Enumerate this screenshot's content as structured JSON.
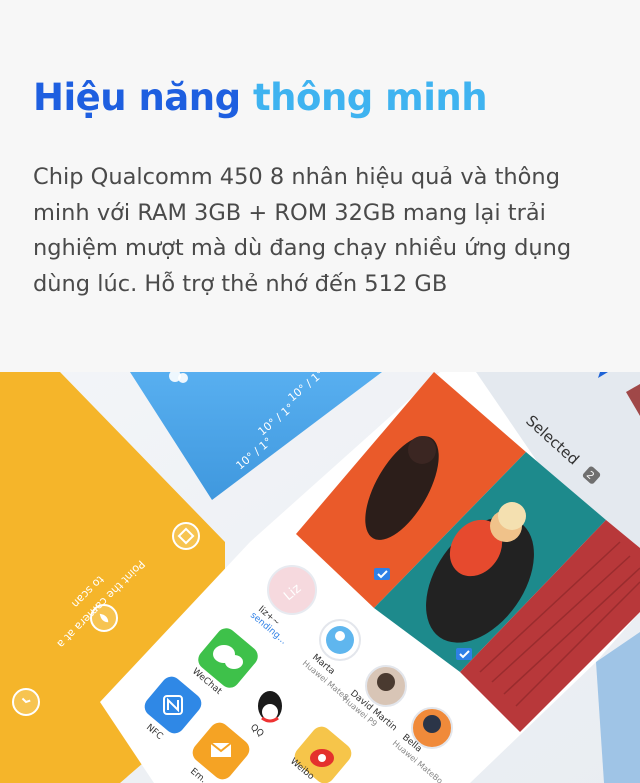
{
  "header": {
    "title_part1": "Hiệu năng",
    "title_part2": "thông minh",
    "description": "Chip Qualcomm 450 8 nhân hiệu quả và thông minh với RAM 3GB + ROM 32GB mang lại trải nghiệm mượt mà dù đang chạy nhiều ứng dụng dùng lúc. Hỗ trợ thẻ nhớ đến 512 GB"
  },
  "colors": {
    "title_primary": "#1e5fe0",
    "title_accent": "#3fb3f0",
    "yellow_card": "#f5b52a",
    "weather_card": "#4ea4e6",
    "photo_orange": "#ea5a2a",
    "photo_teal": "#1d8a8c",
    "brick_red": "#b8383a"
  },
  "scene": {
    "scanner": {
      "instruction_line1": "Point the camera at a",
      "instruction_line2": "to scan",
      "icon_top": "qr-icon",
      "icon_mid": "drop-icon",
      "icon_bottom": "clock-icon"
    },
    "weather": {
      "temps": [
        "10° / 1°",
        "10° / 1°",
        "10° / 1°"
      ],
      "icon": "cloud-icon"
    },
    "gallery": {
      "selected_label": "Selected",
      "selected_count": "2"
    },
    "share": {
      "contacts": [
        {
          "name": "liz+~",
          "sub": "sending...",
          "avatar": "Liz"
        },
        {
          "name": "Marta",
          "sub": "Huawei Mate8",
          "avatar": ""
        },
        {
          "name": "David Martin",
          "sub": "Huawei P9",
          "avatar": ""
        },
        {
          "name": "Bella",
          "sub": "Huawei MateBo...",
          "avatar": ""
        }
      ],
      "apps": [
        {
          "label": "WeChat",
          "icon": "wechat-icon"
        },
        {
          "label": "QQ",
          "icon": "qq-icon"
        },
        {
          "label": "Weibo",
          "icon": "weibo-icon"
        },
        {
          "label": "NFC",
          "icon": "nfc-icon"
        },
        {
          "label": "Em...",
          "icon": "email-icon"
        }
      ]
    }
  }
}
